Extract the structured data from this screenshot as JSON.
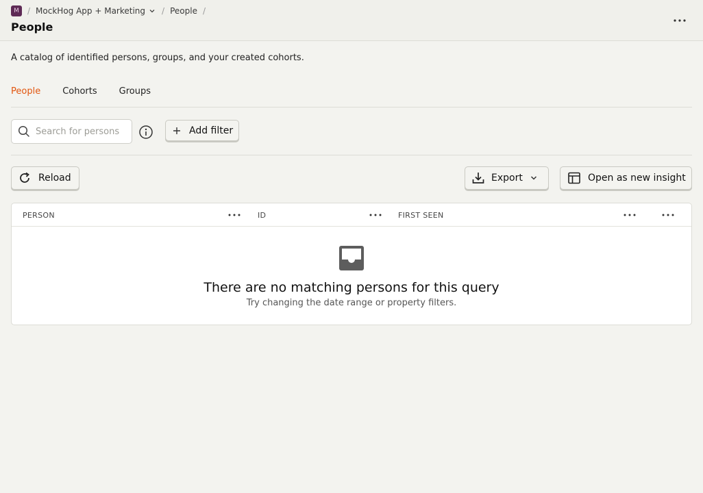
{
  "breadcrumb": {
    "project_initial": "M",
    "project_name": "MockHog App + Marketing",
    "section": "People",
    "separator": "/"
  },
  "page": {
    "title": "People",
    "description": "A catalog of identified persons, groups, and your created cohorts."
  },
  "tabs": [
    {
      "label": "People",
      "active": true
    },
    {
      "label": "Cohorts",
      "active": false
    },
    {
      "label": "Groups",
      "active": false
    }
  ],
  "filters": {
    "search_placeholder": "Search for persons",
    "search_value": "",
    "add_filter_label": "Add filter"
  },
  "toolbar": {
    "reload_label": "Reload",
    "export_label": "Export",
    "open_insight_label": "Open as new insight"
  },
  "table": {
    "columns": [
      "PERSON",
      "ID",
      "FIRST SEEN"
    ],
    "empty_title": "There are no matching persons for this query",
    "empty_subtitle": "Try changing the date range or property filters."
  },
  "colors": {
    "accent": "#e2560f",
    "background": "#f3f3ef",
    "project_badge": "#5e2a55"
  },
  "icons": [
    "chevron-down-icon",
    "more-icon",
    "search-icon",
    "info-icon",
    "plus-icon",
    "reload-icon",
    "download-icon",
    "table-icon",
    "inbox-icon"
  ]
}
